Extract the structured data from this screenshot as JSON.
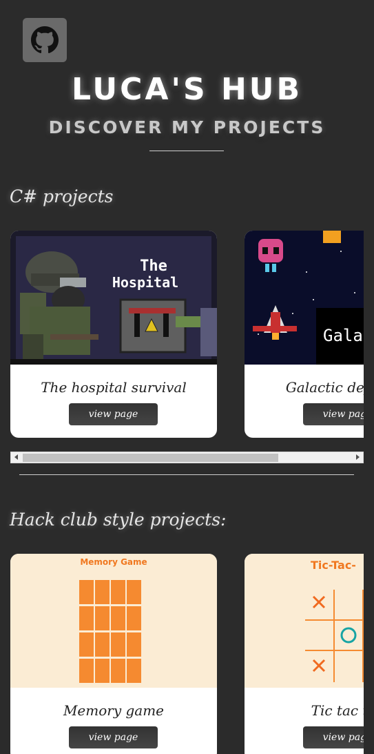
{
  "header": {
    "title": "LUCA'S HUB",
    "subtitle": "DISCOVER MY PROJECTS"
  },
  "sections": [
    {
      "heading": "C# projects",
      "cards": [
        {
          "title": "The hospital survival",
          "button": "view page",
          "thumb_text": [
            "The",
            "Hospital"
          ]
        },
        {
          "title": "Galactic defender",
          "button": "view page",
          "thumb_text": [
            "Galact"
          ]
        }
      ]
    },
    {
      "heading": "Hack club style projects:",
      "cards": [
        {
          "title": "Memory game",
          "button": "view page",
          "thumb_text": [
            "Memory Game"
          ]
        },
        {
          "title": "Tic tac toe",
          "button": "view page",
          "thumb_text": [
            "Tic-Tac-"
          ]
        }
      ]
    }
  ],
  "colors": {
    "background": "#2b2b2b",
    "card": "#ffffff",
    "button": "#3a3a3a",
    "accent": "#f58220"
  },
  "icons": {
    "github": "github-icon"
  }
}
